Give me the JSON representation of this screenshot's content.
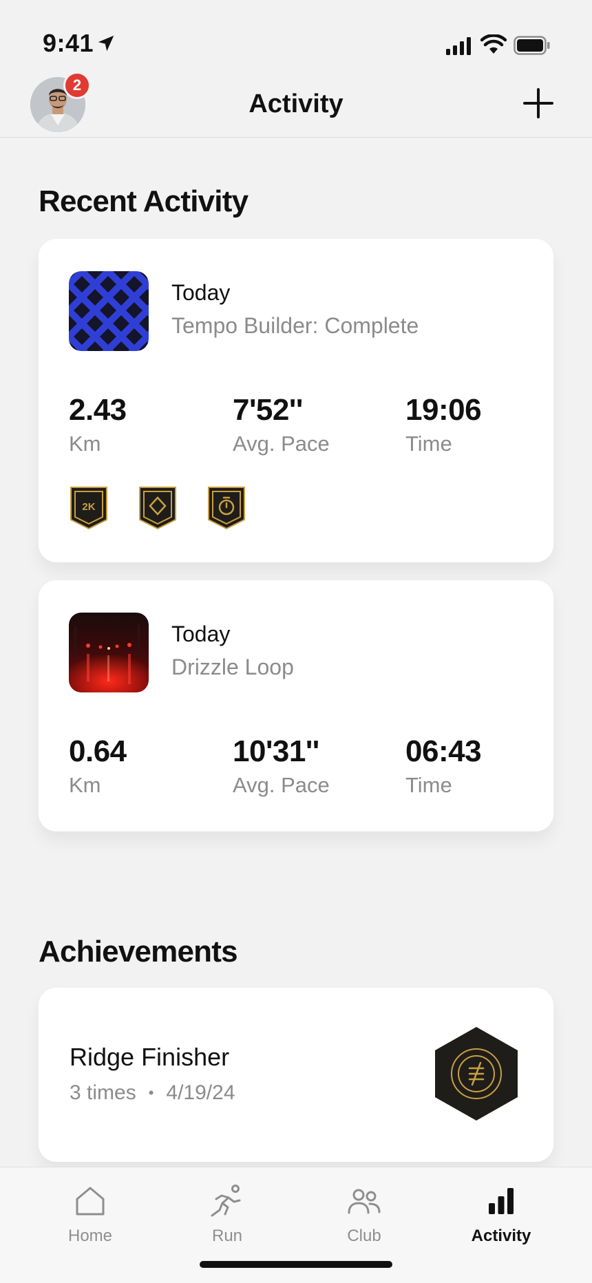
{
  "status_bar": {
    "time": "9:41",
    "icons": [
      "location-arrow-icon",
      "cellular-signal-icon",
      "wifi-icon",
      "battery-icon"
    ]
  },
  "header": {
    "title": "Activity",
    "notification_count": "2",
    "add_icon": "plus-icon"
  },
  "recent_activity": {
    "title": "Recent Activity",
    "items": [
      {
        "day": "Today",
        "name": "Tempo Builder: Complete",
        "stats": [
          {
            "value": "2.43",
            "label": "Km"
          },
          {
            "value": "7'52''",
            "label": "Avg. Pace"
          },
          {
            "value": "19:06",
            "label": "Time"
          }
        ],
        "badges": [
          {
            "icon": "2k-badge-icon",
            "text": "2K"
          },
          {
            "icon": "diamond-badge-icon"
          },
          {
            "icon": "stopwatch-badge-icon"
          }
        ]
      },
      {
        "day": "Today",
        "name": "Drizzle Loop",
        "stats": [
          {
            "value": "0.64",
            "label": "Km"
          },
          {
            "value": "10'31''",
            "label": "Avg. Pace"
          },
          {
            "value": "06:43",
            "label": "Time"
          }
        ]
      }
    ]
  },
  "achievements": {
    "title": "Achievements",
    "items": [
      {
        "name": "Ridge Finisher",
        "count": "3 times",
        "separator": "•",
        "date": "4/19/24",
        "icon": "hexagon-achievement-icon"
      }
    ]
  },
  "tab_bar": {
    "tabs": [
      {
        "label": "Home",
        "icon": "home-icon"
      },
      {
        "label": "Run",
        "icon": "runner-icon"
      },
      {
        "label": "Club",
        "icon": "people-icon"
      },
      {
        "label": "Activity",
        "icon": "bar-chart-icon",
        "active": true
      }
    ]
  },
  "colors": {
    "background": "#f2f2f2",
    "card": "#ffffff",
    "badge_dark": "#1f1d1a",
    "badge_gold": "#c9a040",
    "notification": "#e03a33",
    "muted_text": "#8b8b8b",
    "thumb_blue": "#2f3fd6"
  }
}
